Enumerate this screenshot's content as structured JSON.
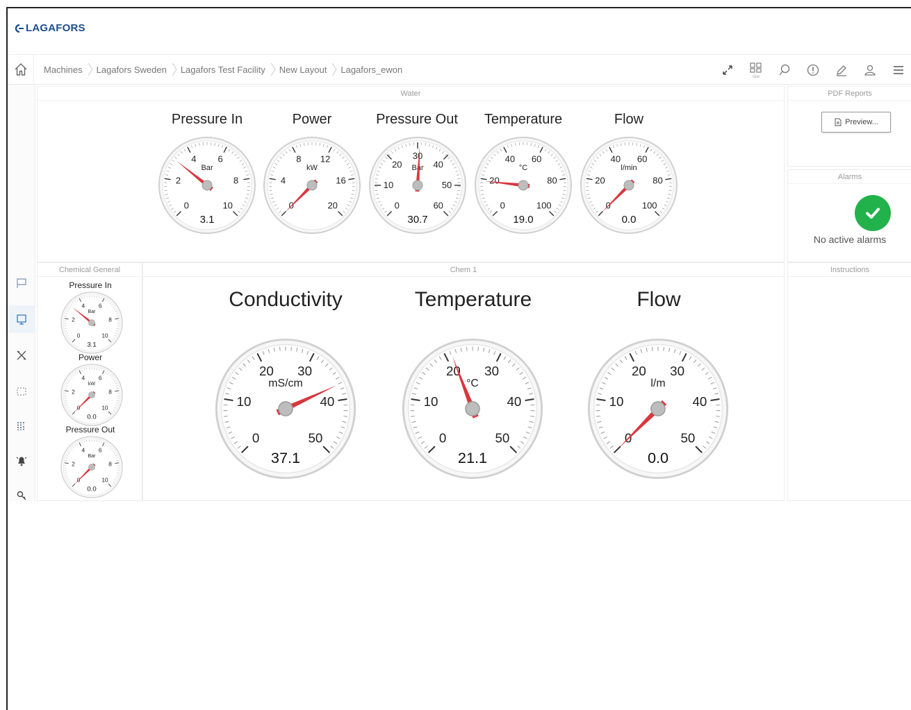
{
  "app": {
    "logo_text": "LAGAFORS"
  },
  "breadcrumb": [
    {
      "label": "Machines"
    },
    {
      "label": "Lagafors Sweden"
    },
    {
      "label": "Lagafors Test Facility"
    },
    {
      "label": "New Layout"
    },
    {
      "label": "Lagafors_ewon"
    }
  ],
  "toolbar": {
    "items": [
      {
        "icon": "expand-icon"
      },
      {
        "icon": "layout-icon",
        "label": "Grid"
      },
      {
        "icon": "search-icon"
      },
      {
        "icon": "alert-icon"
      },
      {
        "icon": "edit-icon"
      },
      {
        "icon": "user-icon"
      },
      {
        "icon": "menu-icon"
      }
    ]
  },
  "sidebar": {
    "items": [
      {
        "icon": "flag-icon",
        "active": false
      },
      {
        "icon": "dashboard-icon",
        "active": true
      },
      {
        "icon": "tools-icon",
        "active": false
      },
      {
        "icon": "selection-icon",
        "active": false
      },
      {
        "icon": "list-icon",
        "active": false
      },
      {
        "icon": "alarm-bell-icon",
        "active": false
      },
      {
        "icon": "key-icon",
        "active": false
      }
    ]
  },
  "panels": {
    "water": {
      "title": "Water",
      "gauges": [
        {
          "label": "Pressure In",
          "unit": "Bar",
          "value": 3.1,
          "display": "3.1",
          "min": 0,
          "max": 10,
          "ticks": [
            "0",
            "2",
            "4",
            "6",
            "8",
            "10"
          ]
        },
        {
          "label": "Power",
          "unit": "kW",
          "value": 0,
          "display": "",
          "min": 0,
          "max": 20,
          "ticks": [
            "0",
            "4",
            "8",
            "12",
            "16",
            "20"
          ]
        },
        {
          "label": "Pressure Out",
          "unit": "Bar",
          "value": 30.7,
          "display": "30.7",
          "min": 0,
          "max": 60,
          "ticks": [
            "0",
            "10",
            "20",
            "30",
            "40",
            "50",
            "60"
          ]
        },
        {
          "label": "Temperature",
          "unit": "°C",
          "value": 19.0,
          "display": "19.0",
          "min": 0,
          "max": 100,
          "ticks": [
            "0",
            "20",
            "40",
            "60",
            "80",
            "100"
          ]
        },
        {
          "label": "Flow",
          "unit": "l/min",
          "value": 0.0,
          "display": "0.0",
          "min": 0,
          "max": 100,
          "ticks": [
            "0",
            "20",
            "40",
            "60",
            "80",
            "100"
          ]
        }
      ]
    },
    "pdf_reports": {
      "title": "PDF Reports",
      "button_label": "Preview..."
    },
    "alarms": {
      "title": "Alarms",
      "status_text": "No active alarms",
      "status_color": "#22b24c"
    },
    "chemical_general": {
      "title": "Chemical General",
      "gauges": [
        {
          "label": "Pressure In",
          "unit": "Bar",
          "value": 3.1,
          "display": "3.1",
          "min": 0,
          "max": 10,
          "ticks": [
            "0",
            "2",
            "4",
            "6",
            "8",
            "10"
          ]
        },
        {
          "label": "Power",
          "unit": "kW",
          "value": 0.0,
          "display": "0.0",
          "min": 0,
          "max": 10,
          "ticks": [
            "0",
            "2",
            "4",
            "6",
            "8",
            "10"
          ]
        },
        {
          "label": "Pressure Out",
          "unit": "Bar",
          "value": 0.0,
          "display": "0.0",
          "min": 0,
          "max": 10,
          "ticks": [
            "0",
            "2",
            "4",
            "6",
            "8",
            "10"
          ]
        }
      ]
    },
    "chem1": {
      "title": "Chem 1",
      "gauges": [
        {
          "label": "Conductivity",
          "unit": "mS/cm",
          "value": 37.1,
          "display": "37.1",
          "min": 0,
          "max": 50,
          "ticks": [
            "0",
            "10",
            "20",
            "30",
            "40",
            "50"
          ]
        },
        {
          "label": "Temperature",
          "unit": "°C",
          "value": 21.1,
          "display": "21.1",
          "min": 0,
          "max": 50,
          "ticks": [
            "0",
            "10",
            "20",
            "30",
            "40",
            "50"
          ]
        },
        {
          "label": "Flow",
          "unit": "l/m",
          "value": 0.0,
          "display": "0.0",
          "min": 0,
          "max": 50,
          "ticks": [
            "0",
            "10",
            "20",
            "30",
            "40",
            "50"
          ]
        }
      ]
    },
    "instructions": {
      "title": "Instructions"
    }
  },
  "colors": {
    "needle": "#d9363e",
    "accent": "#1d4f8c",
    "ok": "#22b24c"
  }
}
